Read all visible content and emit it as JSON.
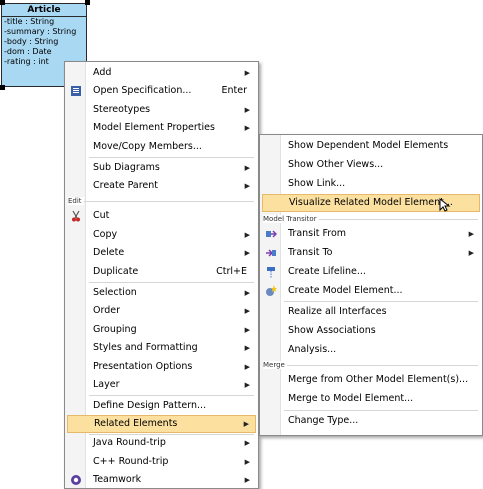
{
  "uml_class": {
    "name": "Article",
    "attributes": [
      "-title : String",
      "-summary : String",
      "-body : String",
      "-dom : Date",
      "-rating : int"
    ]
  },
  "context_menu": {
    "items": {
      "add": "Add",
      "open_spec": "Open Specification...",
      "open_spec_sc": "Enter",
      "stereotypes": "Stereotypes",
      "model_props": "Model Element Properties",
      "move_copy": "Move/Copy Members...",
      "sub_diagrams": "Sub Diagrams",
      "create_parent": "Create Parent",
      "edit_header": "Edit",
      "cut": "Cut",
      "copy": "Copy",
      "delete": "Delete",
      "duplicate": "Duplicate",
      "duplicate_sc": "Ctrl+E",
      "selection": "Selection",
      "order": "Order",
      "grouping": "Grouping",
      "styles": "Styles and Formatting",
      "presentation": "Presentation Options",
      "layer": "Layer",
      "define_pattern": "Define Design Pattern...",
      "related": "Related Elements",
      "java": "Java Round-trip",
      "cpp": "C++ Round-trip",
      "teamwork": "Teamwork"
    }
  },
  "submenu": {
    "items": {
      "show_dependent": "Show Dependent Model Elements",
      "show_views": "Show Other Views...",
      "show_link": "Show Link...",
      "visualize": "Visualize Related Model Element...",
      "transitor_header": "Model Transitor",
      "transit_from": "Transit From",
      "transit_to": "Transit To",
      "create_lifeline": "Create Lifeline...",
      "create_model": "Create Model Element...",
      "realize": "Realize all Interfaces",
      "show_assoc": "Show Associations",
      "analysis": "Analysis...",
      "merge_header": "Merge",
      "merge_from": "Merge from Other Model Element(s)...",
      "merge_to": "Merge to Model Element...",
      "change_type": "Change Type..."
    }
  },
  "colors": {
    "highlight": "#fbe0a0",
    "uml_fill": "#a9d8f3"
  }
}
